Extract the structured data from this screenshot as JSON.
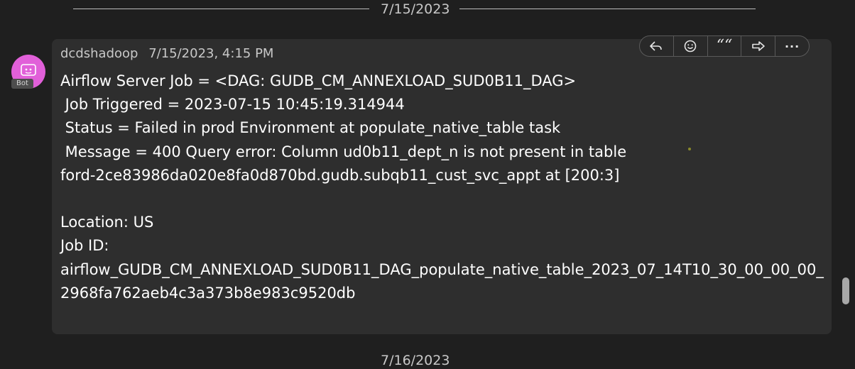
{
  "dividers": {
    "top_date": "7/15/2023",
    "bottom_date": "7/16/2023"
  },
  "message": {
    "sender": "dcdshadoop",
    "timestamp": "7/15/2023, 4:15 PM",
    "badge": "Bot",
    "lines": [
      "Airflow Server Job = <DAG: GUDB_CM_ANNEXLOAD_SUD0B11_DAG>",
      " Job Triggered = 2023-07-15 10:45:19.314944",
      " Status = Failed in prod Environment at populate_native_table task",
      " Message = 400 Query error: Column ud0b11_dept_n is not present in table",
      "ford-2ce83986da020e8fa0d870bd.gudb.subqb11_cust_svc_appt at [200:3]",
      "",
      "Location: US",
      "Job ID:",
      "airflow_GUDB_CM_ANNEXLOAD_SUD0B11_DAG_populate_native_table_2023_07_14T10_30_00_00_00_",
      "2968fa762aeb4c3a373b8e983c9520db"
    ]
  },
  "actions": {
    "reply_icon": "reply-icon",
    "react_icon": "emoji-icon",
    "quote_icon": "quote-icon",
    "forward_icon": "forward-icon",
    "more_icon": "more-icon",
    "quote_glyph": "““",
    "more_glyph": "···"
  },
  "colors": {
    "background": "#1f1f1f",
    "bubble": "#2e2e2e",
    "avatar": "#e160d9"
  }
}
